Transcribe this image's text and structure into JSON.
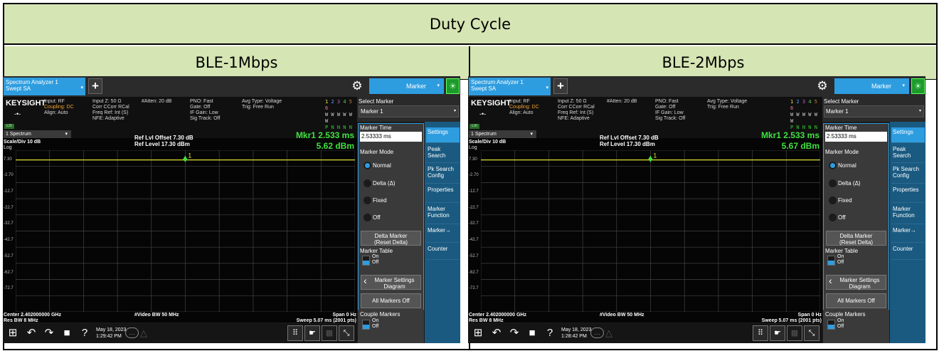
{
  "title": "Duty Cycle",
  "column_labels": [
    "BLE-1Mbps",
    "BLE-2Mbps"
  ],
  "screens": [
    {
      "tab_line1": "Spectrum Analyzer 1",
      "tab_line2": "Swept SA",
      "marker_dropdown": "Marker",
      "brand": "KEYSIGHT",
      "input_rf": "Input: RF",
      "coupling": "Coupling: DC",
      "align": "Align: Auto",
      "input_z": "Input Z: 50 Ω",
      "corr": "Corr CCorr RCal",
      "freq_ref": "Freq Ref: Int (S)",
      "nfe": "NFE: Adaptive",
      "atten": "#Atten: 20 dB",
      "pno": "PNO: Fast",
      "gate": "Gate: Off",
      "if_gain": "IF Gain: Low",
      "sig_track": "Sig Track: Off",
      "avg_type": "Avg Type: Voltage",
      "trig": "Trig: Free Run",
      "lxi": "LXI",
      "spectrum_select": "1 Spectrum",
      "scale": "Scale/Div 10 dB",
      "log": "Log",
      "ref_offset": "Ref Lvl Offset 7.30 dB",
      "ref_level": "Ref Level 17.30 dBm",
      "mkr_time": "Mkr1  2.533 ms",
      "mkr_level": "5.62 dBm",
      "marker_label": "1",
      "y_ticks": [
        "7.30",
        "-2.70",
        "-12.7",
        "-22.7",
        "-32.7",
        "-42.7",
        "-52.7",
        "-62.7",
        "-72.7"
      ],
      "center": "Center 2.402000000 GHz",
      "res_bw": "Res BW 8 MHz",
      "video_bw": "#Video BW 50 MHz",
      "span": "Span 0 Hz",
      "sweep": "Sweep 5.07 ms (2001 pts)",
      "date": "May 18, 2023",
      "time": "1:29:42 PM",
      "select_marker": "Select Marker",
      "marker_1": "Marker 1",
      "marker_time_label": "Marker Time",
      "marker_time_value": "2.53333 ms",
      "marker_mode": "Marker Mode",
      "mode_normal": "Normal",
      "mode_delta": "Delta (Δ)",
      "mode_fixed": "Fixed",
      "mode_off": "Off",
      "delta_marker_1": "Delta Marker",
      "delta_marker_2": "(Reset Delta)",
      "marker_table": "Marker Table",
      "on": "On",
      "off": "Off",
      "marker_settings_1": "Marker Settings",
      "marker_settings_2": "Diagram",
      "all_markers_off": "All Markers Off",
      "couple_markers": "Couple Markers",
      "rtabs": [
        "Settings",
        "Peak Search",
        "Pk Search Config",
        "Properties",
        "Marker Function",
        "Marker→",
        "Counter"
      ]
    },
    {
      "tab_line1": "Spectrum Analyzer 1",
      "tab_line2": "Swept SA",
      "marker_dropdown": "Marker",
      "brand": "KEYSIGHT",
      "input_rf": "Input: RF",
      "coupling": "Coupling: DC",
      "align": "Align: Auto",
      "input_z": "Input Z: 50 Ω",
      "corr": "Corr CCorr RCal",
      "freq_ref": "Freq Ref: Int (S)",
      "nfe": "NFE: Adaptive",
      "atten": "#Atten: 20 dB",
      "pno": "PNO: Fast",
      "gate": "Gate: Off",
      "if_gain": "IF Gain: Low",
      "sig_track": "Sig Track: Off",
      "avg_type": "Avg Type: Voltage",
      "trig": "Trig: Free Run",
      "lxi": "LXI",
      "spectrum_select": "1 Spectrum",
      "scale": "Scale/Div 10 dB",
      "log": "Log",
      "ref_offset": "Ref Lvl Offset 7.30 dB",
      "ref_level": "Ref Level 17.30 dBm",
      "mkr_time": "Mkr1  2.533 ms",
      "mkr_level": "5.67 dBm",
      "marker_label": "1",
      "y_ticks": [
        "7.30",
        "-2.70",
        "-12.7",
        "-22.7",
        "-32.7",
        "-42.7",
        "-52.7",
        "-62.7",
        "-72.7"
      ],
      "center": "Center 2.402000000 GHz",
      "res_bw": "Res BW 8 MHz",
      "video_bw": "#Video BW 50 MHz",
      "span": "Span 0 Hz",
      "sweep": "Sweep 5.07 ms (2001 pts)",
      "date": "May 18, 2023",
      "time": "1:28:42 PM",
      "select_marker": "Select Marker",
      "marker_1": "Marker 1",
      "marker_time_label": "Marker Time",
      "marker_time_value": "2.53333 ms",
      "marker_mode": "Marker Mode",
      "mode_normal": "Normal",
      "mode_delta": "Delta (Δ)",
      "mode_fixed": "Fixed",
      "mode_off": "Off",
      "delta_marker_1": "Delta Marker",
      "delta_marker_2": "(Reset Delta)",
      "marker_table": "Marker Table",
      "on": "On",
      "off": "Off",
      "marker_settings_1": "Marker Settings",
      "marker_settings_2": "Diagram",
      "all_markers_off": "All Markers Off",
      "couple_markers": "Couple Markers",
      "rtabs": [
        "Settings",
        "Peak Search",
        "Pk Search Config",
        "Properties",
        "Marker Function",
        "Marker→",
        "Counter"
      ]
    }
  ],
  "colors": {
    "header_bg": "#d6e5b4",
    "accent": "#2e9de0",
    "marker_green": "#3fe03f",
    "trace": "#e0e030"
  }
}
